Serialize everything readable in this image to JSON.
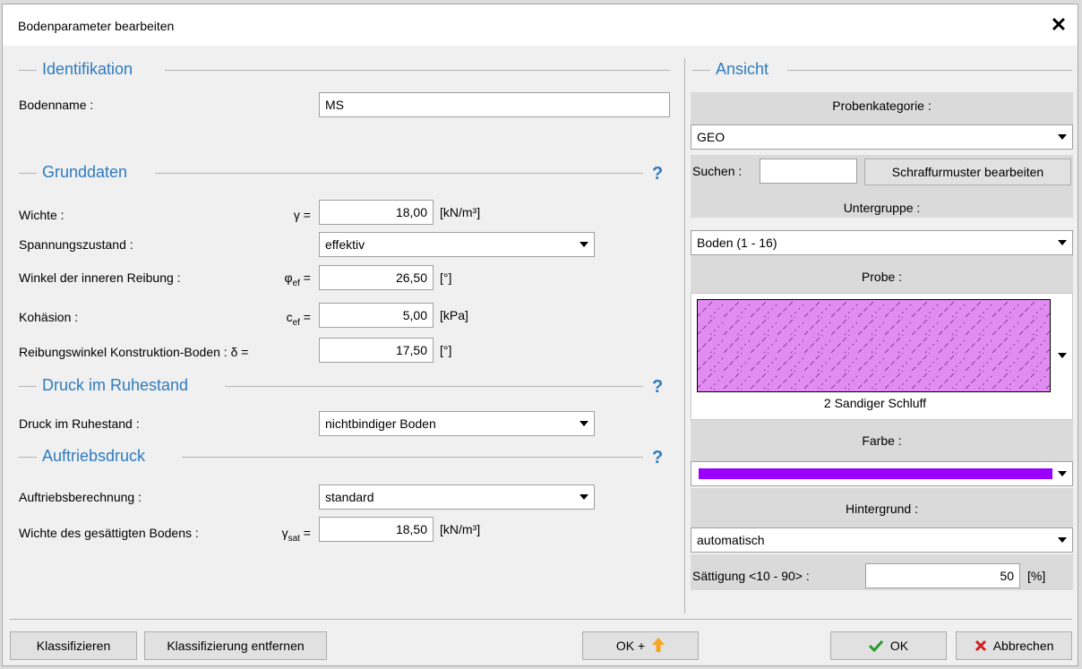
{
  "dialog": {
    "title": "Bodenparameter bearbeiten",
    "close_icon": "✕"
  },
  "identifikation": {
    "title": "Identifikation",
    "bodenname_label": "Bodenname :",
    "bodenname_value": "MS"
  },
  "grunddaten": {
    "title": "Grunddaten",
    "help": "?",
    "wichte": {
      "label": "Wichte :",
      "sym": "γ =",
      "value": "18,00",
      "unit": "[kN/m³]"
    },
    "spannung": {
      "label": "Spannungszustand :",
      "value": "effektiv"
    },
    "winkel": {
      "label": "Winkel der inneren Reibung :",
      "sym": "φ",
      "sub": "ef",
      "eq": " =",
      "value": "26,50",
      "unit": "[°]"
    },
    "kohaesion": {
      "label": "Kohäsion :",
      "sym": "c",
      "sub": "ef",
      "eq": " =",
      "value": "5,00",
      "unit": "[kPa]"
    },
    "reibung": {
      "label": "Reibungswinkel Konstruktion-Boden : δ =",
      "value": "17,50",
      "unit": "[°]"
    }
  },
  "druck": {
    "title": "Druck im Ruhestand",
    "help": "?",
    "label": "Druck im Ruhestand :",
    "value": "nichtbindiger Boden"
  },
  "auftrieb": {
    "title": "Auftriebsdruck",
    "help": "?",
    "berechnung_label": "Auftriebsberechnung :",
    "berechnung_value": "standard",
    "gesaettigt": {
      "label": "Wichte des gesättigten Bodens :",
      "sym": "γ",
      "sub": "sat",
      "eq": " =",
      "value": "18,50",
      "unit": "[kN/m³]"
    }
  },
  "ansicht": {
    "title": "Ansicht",
    "probenkategorie_label": "Probenkategorie :",
    "probenkategorie_value": "GEO",
    "suchen_label": "Suchen :",
    "suchen_value": "",
    "schraffur_button": "Schraffurmuster bearbeiten",
    "untergruppe_label": "Untergruppe :",
    "untergruppe_value": "Boden (1 - 16)",
    "probe_label": "Probe :",
    "probe_name": "2 Sandiger Schluff",
    "farbe_label": "Farbe :",
    "hintergrund_label": "Hintergrund :",
    "hintergrund_value": "automatisch",
    "saettigung_label": "Sättigung <10 - 90> :",
    "saettigung_value": "50",
    "saettigung_unit": "[%]"
  },
  "colors": {
    "accent": "#2e7bbf",
    "farbe": "#9900ff",
    "probe_fill": "#e08cf0"
  },
  "buttons": {
    "klassifizieren": "Klassifizieren",
    "klassifizierung_entfernen": "Klassifizierung entfernen",
    "ok_plus": "OK +",
    "ok": "OK",
    "abbrechen": "Abbrechen"
  }
}
